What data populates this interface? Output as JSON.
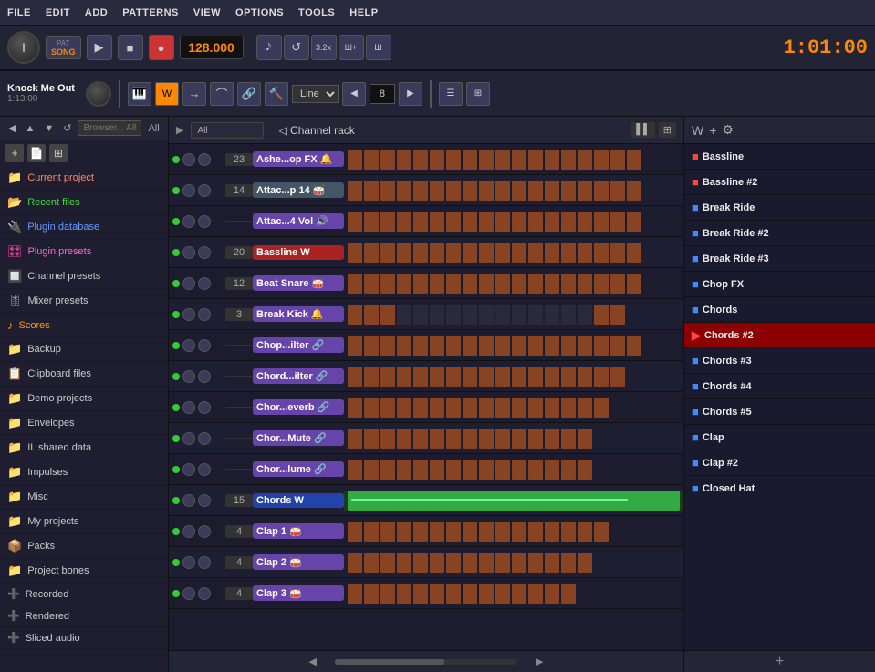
{
  "menu": {
    "items": [
      "FILE",
      "EDIT",
      "ADD",
      "PATTERNS",
      "VIEW",
      "OPTIONS",
      "TOOLS",
      "HELP"
    ]
  },
  "transport": {
    "bpm": "128.000",
    "time": "1:01:00",
    "pat_label": "PAT",
    "song_label": "SONG"
  },
  "song_editor": {
    "title": "Knock Me Out",
    "duration": "1:13:00",
    "line_label": "Line",
    "snap_value": "8"
  },
  "browser": {
    "search_placeholder": "Browser... All",
    "items": [
      {
        "id": "current-project",
        "label": "Current project",
        "icon": "📁",
        "color": "#ff6644"
      },
      {
        "id": "recent-files",
        "label": "Recent files",
        "icon": "📂",
        "color": "#44aa44"
      },
      {
        "id": "plugin-database",
        "label": "Plugin database",
        "icon": "🔌",
        "color": "#4488ff"
      },
      {
        "id": "plugin-presets",
        "label": "Plugin presets",
        "icon": "🎛",
        "color": "#ff44aa"
      },
      {
        "id": "channel-presets",
        "label": "Channel presets",
        "icon": "🔲",
        "color": "#aaaaaa"
      },
      {
        "id": "mixer-presets",
        "label": "Mixer presets",
        "icon": "🎚",
        "color": "#aaaaaa"
      },
      {
        "id": "scores",
        "label": "Scores",
        "icon": "♪",
        "color": "#ff8800"
      },
      {
        "id": "backup",
        "label": "Backup",
        "icon": "📁",
        "color": "#44aa44"
      },
      {
        "id": "clipboard-files",
        "label": "Clipboard files",
        "icon": "📋",
        "color": "#aaaaaa"
      },
      {
        "id": "demo-projects",
        "label": "Demo projects",
        "icon": "📁",
        "color": "#aaaaaa"
      },
      {
        "id": "envelopes",
        "label": "Envelopes",
        "icon": "📁",
        "color": "#aaaaaa"
      },
      {
        "id": "il-shared-data",
        "label": "IL shared data",
        "icon": "📁",
        "color": "#44aa44"
      },
      {
        "id": "impulses",
        "label": "Impulses",
        "icon": "📁",
        "color": "#aaaaaa"
      },
      {
        "id": "misc",
        "label": "Misc",
        "icon": "📁",
        "color": "#aaaaaa"
      },
      {
        "id": "my-projects",
        "label": "My projects",
        "icon": "📁",
        "color": "#aaaaaa"
      },
      {
        "id": "packs",
        "label": "Packs",
        "icon": "📦",
        "color": "#44aa44"
      },
      {
        "id": "project-bones",
        "label": "Project bones",
        "icon": "📁",
        "color": "#44aa44"
      },
      {
        "id": "recorded",
        "label": "Recorded",
        "icon": "➕",
        "color": "#aaaaaa"
      },
      {
        "id": "rendered",
        "label": "Rendered",
        "icon": "➕",
        "color": "#aaaaaa"
      },
      {
        "id": "sliced-audio",
        "label": "Sliced audio",
        "icon": "➕",
        "color": "#aaaaaa"
      }
    ]
  },
  "channel_rack": {
    "title": "Channel rack",
    "all_label": "All",
    "channels": [
      {
        "name": "Ashe...op FX",
        "number": "23",
        "type": "purple",
        "icon": "🔔"
      },
      {
        "name": "Attac...p 14",
        "number": "14",
        "type": "gray",
        "icon": "🥁"
      },
      {
        "name": "Attac...4 Vol",
        "number": "",
        "type": "purple",
        "icon": "🔊"
      },
      {
        "name": "Bassline",
        "number": "20",
        "type": "red",
        "icon": "W"
      },
      {
        "name": "Beat Snare",
        "number": "12",
        "type": "purple",
        "icon": "🥁"
      },
      {
        "name": "Break Kick",
        "number": "3",
        "type": "purple",
        "icon": "🔔"
      },
      {
        "name": "Chop...ilter",
        "number": "",
        "type": "purple",
        "icon": "🔗"
      },
      {
        "name": "Chord...ilter",
        "number": "",
        "type": "purple",
        "icon": "🔗"
      },
      {
        "name": "Chor...everb",
        "number": "",
        "type": "purple",
        "icon": "🔗"
      },
      {
        "name": "Chor...Mute",
        "number": "",
        "type": "purple",
        "icon": "🔗"
      },
      {
        "name": "Chor...lume",
        "number": "",
        "type": "purple",
        "icon": "🔗"
      },
      {
        "name": "Chords",
        "number": "15",
        "type": "blue",
        "icon": "W"
      },
      {
        "name": "Clap 1",
        "number": "4",
        "type": "purple",
        "icon": "🥁"
      },
      {
        "name": "Clap 2",
        "number": "4",
        "type": "purple",
        "icon": "🥁"
      },
      {
        "name": "Clap 3",
        "number": "4",
        "type": "purple",
        "icon": "🥁"
      }
    ]
  },
  "playlist": {
    "items": [
      {
        "label": "Bassline",
        "prefix": "■",
        "color": "#cc4444"
      },
      {
        "label": "Bassline #2",
        "prefix": "■",
        "color": "#cc4444"
      },
      {
        "label": "Break Ride",
        "prefix": "■",
        "color": "#4455cc"
      },
      {
        "label": "Break Ride #2",
        "prefix": "■",
        "color": "#4455cc"
      },
      {
        "label": "Break Ride #3",
        "prefix": "■",
        "color": "#4455cc"
      },
      {
        "label": "Chop FX",
        "prefix": "■",
        "color": "#4455cc"
      },
      {
        "label": "Chords",
        "prefix": "■",
        "color": "#4455cc"
      },
      {
        "label": "Chords #2",
        "prefix": "▶",
        "color": "#cc4444",
        "selected": true
      },
      {
        "label": "Chords #3",
        "prefix": "■",
        "color": "#4455cc"
      },
      {
        "label": "Chords #4",
        "prefix": "■",
        "color": "#4455cc"
      },
      {
        "label": "Chords #5",
        "prefix": "■",
        "color": "#4455cc"
      },
      {
        "label": "Clap",
        "prefix": "■",
        "color": "#4455cc"
      },
      {
        "label": "Clap #2",
        "prefix": "■",
        "color": "#4455cc"
      },
      {
        "label": "Closed Hat",
        "prefix": "■",
        "color": "#4455cc"
      }
    ],
    "add_label": "+"
  }
}
